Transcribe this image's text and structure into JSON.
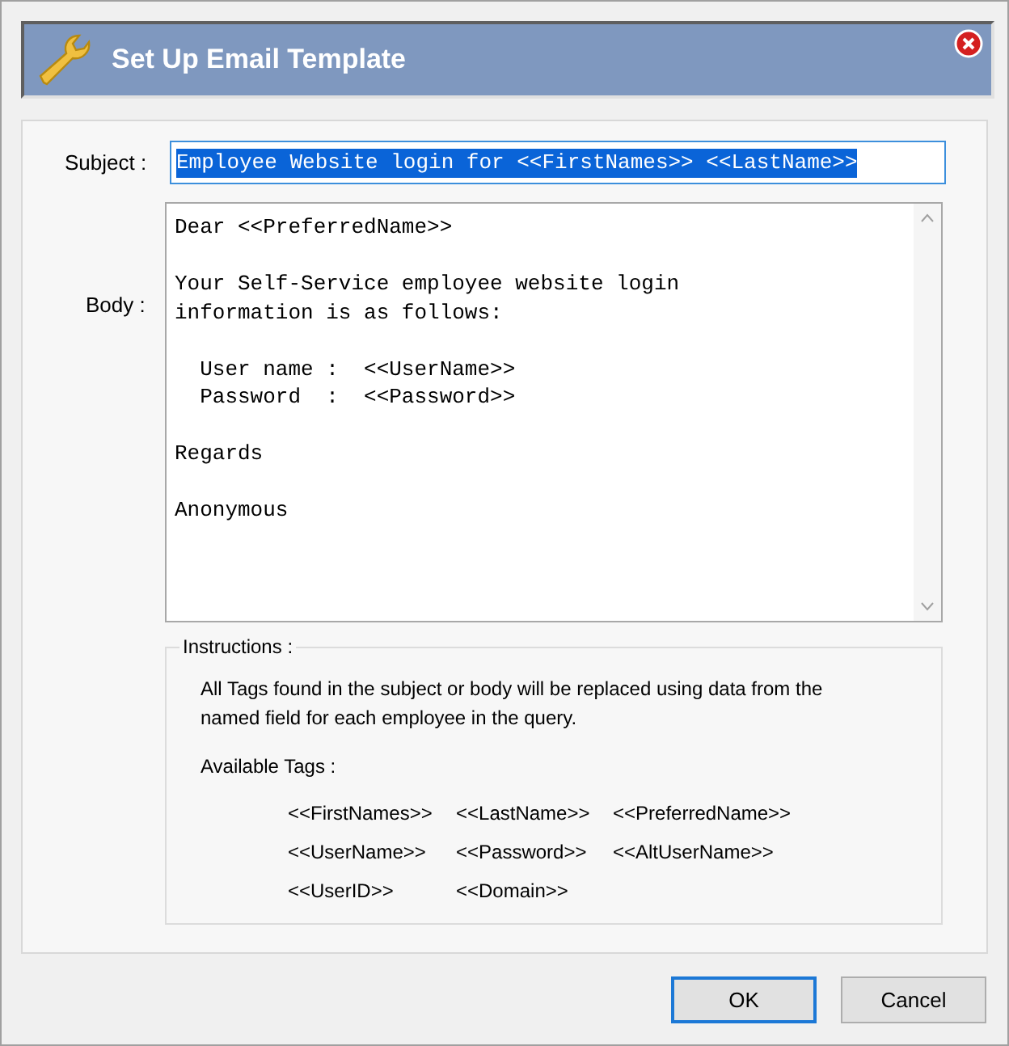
{
  "window": {
    "title": "Set Up Email Template"
  },
  "subject": {
    "label": "Subject :",
    "value": "Employee Website login for <<FirstNames>> <<LastName>>",
    "selected": true
  },
  "body": {
    "label": "Body :",
    "value": "Dear <<PreferredName>>\n\nYour Self-Service employee website login\ninformation is as follows:\n\n  User name :  <<UserName>>\n  Password  :  <<Password>>\n\nRegards\n\nAnonymous"
  },
  "instructions": {
    "title": "Instructions :",
    "text": "All Tags found in the subject or body will be replaced using data from the named field for each employee in the query.",
    "tags_label": "Available Tags :",
    "tags": [
      [
        "<<FirstNames>>",
        "<<LastName>>",
        "<<PreferredName>>"
      ],
      [
        "<<UserName>>",
        "<<Password>>",
        "<<AltUserName>>"
      ],
      [
        "<<UserID>>",
        "<<Domain>>"
      ]
    ]
  },
  "buttons": [
    {
      "label": "OK",
      "default": true
    },
    {
      "label": "Cancel",
      "default": false
    }
  ]
}
